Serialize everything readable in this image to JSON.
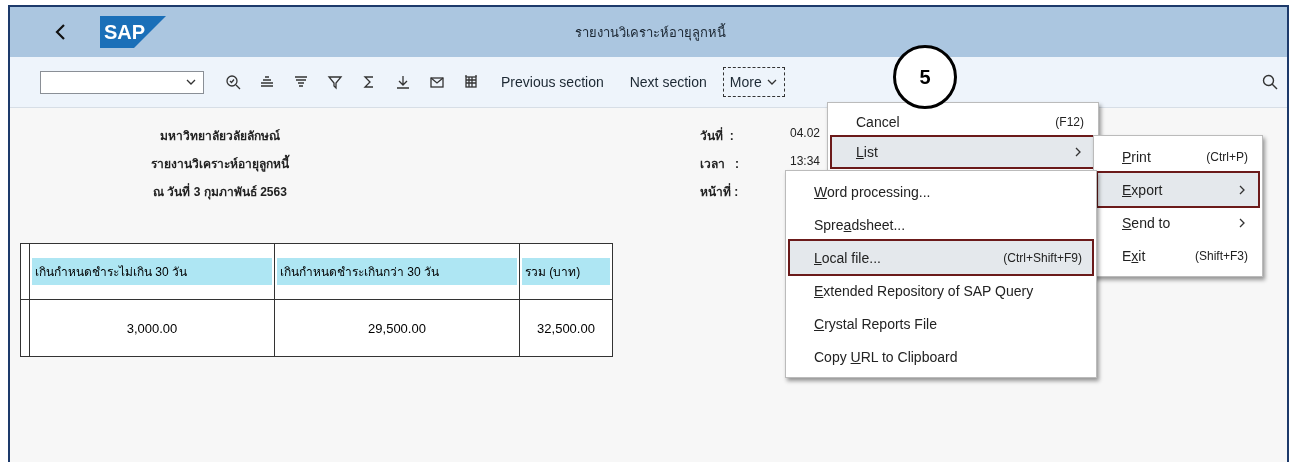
{
  "header": {
    "logo": "SAP",
    "title": "รายงานวิเคราะห์อายุลูกหนี้"
  },
  "toolbar": {
    "buttons": [
      {
        "kind": "zoom"
      },
      {
        "kind": "sort-asc"
      },
      {
        "kind": "sort-desc"
      },
      {
        "kind": "filter"
      },
      {
        "kind": "sum"
      },
      {
        "kind": "download"
      },
      {
        "kind": "mail"
      },
      {
        "kind": "grid"
      }
    ],
    "text_buttons": [
      "Previous section",
      "Next section"
    ],
    "more": {
      "label": "More",
      "focused": true
    }
  },
  "annotation": {
    "label": "5"
  },
  "report": {
    "title_lines": [
      "มหาวิทยาลัยวลัยลักษณ์",
      "รายงานวิเคราะห์อายุลูกหนี้",
      "ณ วันที่ 3 กุมภาพันธ์ 2563"
    ],
    "meta": [
      {
        "label": "วันที่  :",
        "value": "04.02"
      },
      {
        "label": "เวลา   :",
        "value": "13:34"
      },
      {
        "label": "หน้าที่ :"
      }
    ],
    "table": {
      "columns": [
        "เกินกำหนดชำระไม่เกิน 30 วัน",
        "เกินกำหนดชำระเกินกว่า 30 วัน",
        "รวม (บาท)"
      ],
      "rows": [
        [
          "3,000.00",
          "29,500.00",
          "32,500.00"
        ]
      ]
    }
  },
  "more_menu": [
    {
      "post": "Cancel",
      "shortcut": "(F12)",
      "submenu": false,
      "selected": false
    },
    {
      "key": "L",
      "post": "ist",
      "submenu": true,
      "selected": true
    }
  ],
  "list_menu": [
    {
      "key": "P",
      "post": "rint",
      "shortcut": "(Ctrl+P)",
      "submenu": false,
      "selected": false
    },
    {
      "key": "E",
      "post": "xport",
      "submenu": true,
      "selected": true
    },
    {
      "key": "S",
      "post": "end to",
      "submenu": true,
      "selected": false
    },
    {
      "pre": "E",
      "key": "x",
      "post": "it",
      "shortcut": "(Shift+F3)",
      "submenu": false,
      "selected": false
    }
  ],
  "export_menu": [
    {
      "key": "W",
      "post": "ord processing...",
      "submenu": false,
      "selected": false
    },
    {
      "pre": "Spre",
      "key": "a",
      "post": "dsheet...",
      "submenu": false,
      "selected": false
    },
    {
      "key": "L",
      "post": "ocal file...",
      "shortcut": "(Ctrl+Shift+F9)",
      "submenu": false,
      "selected": true
    },
    {
      "key": "E",
      "post": "xtended Repository of SAP Query",
      "submenu": false,
      "selected": false
    },
    {
      "key": "C",
      "post": "rystal Reports File",
      "submenu": false,
      "selected": false
    },
    {
      "pre": "Copy ",
      "key": "U",
      "post": "RL to Clipboard",
      "submenu": false,
      "selected": false
    }
  ]
}
